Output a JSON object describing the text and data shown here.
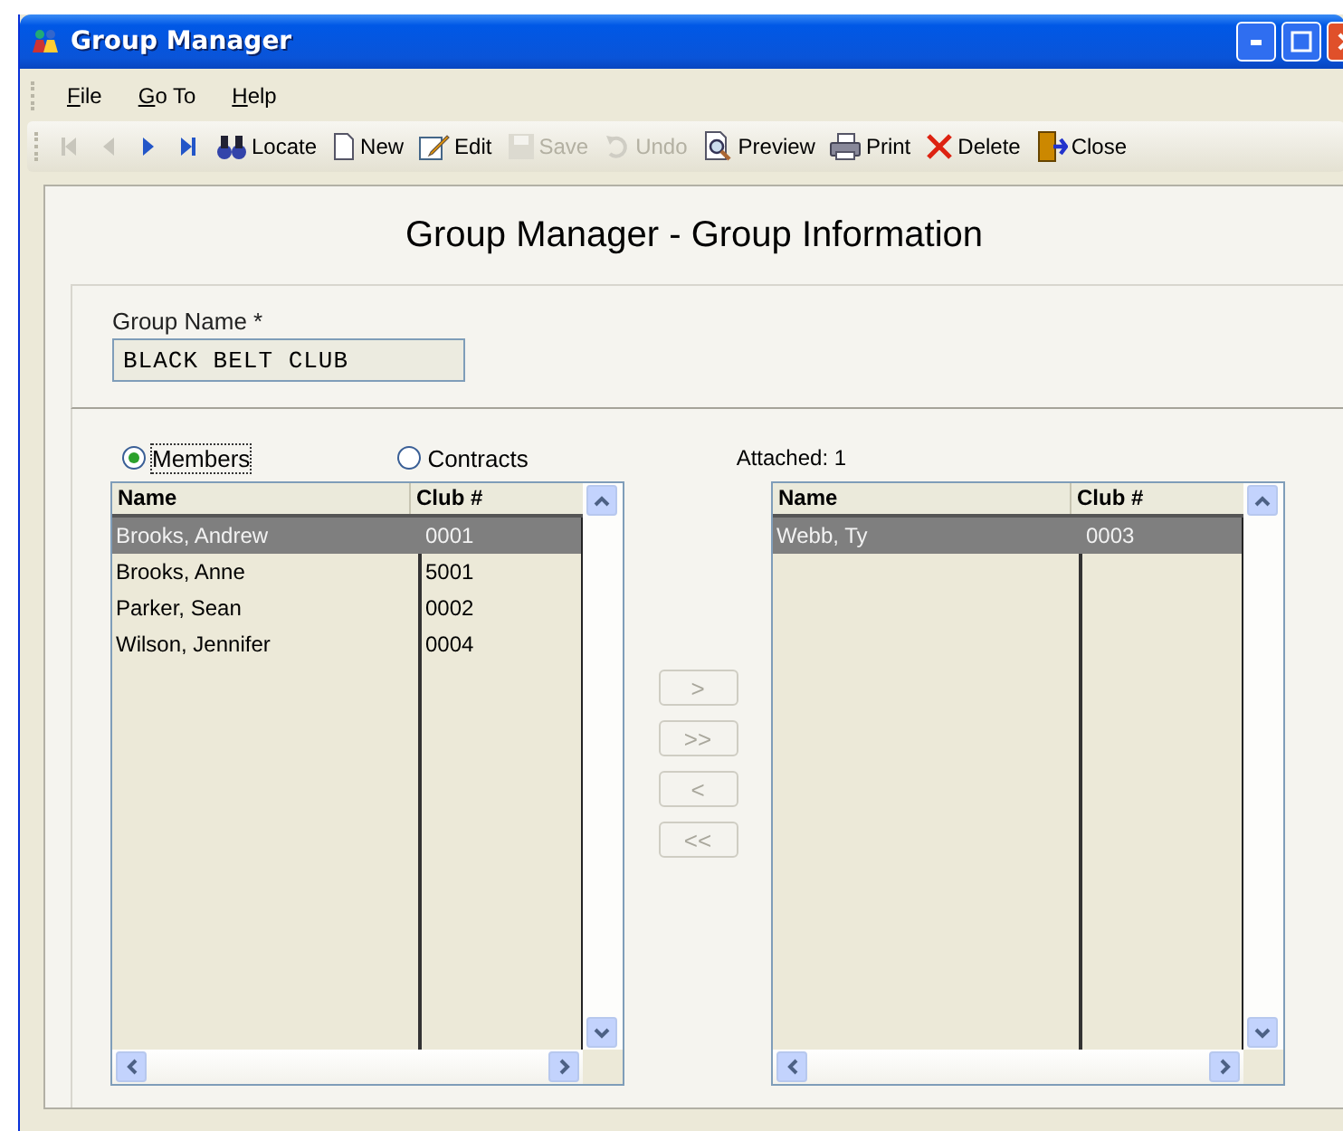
{
  "window": {
    "title": "Group Manager"
  },
  "menu": [
    {
      "label": "File"
    },
    {
      "label": "Go To"
    },
    {
      "label": "Help"
    }
  ],
  "toolbar": [
    {
      "kind": "first",
      "disabled": true
    },
    {
      "kind": "prev",
      "disabled": true
    },
    {
      "kind": "next",
      "disabled": false
    },
    {
      "kind": "last",
      "disabled": false
    },
    {
      "kind": "locate",
      "label": "Locate",
      "disabled": false
    },
    {
      "kind": "new",
      "label": "New",
      "disabled": false
    },
    {
      "kind": "edit",
      "label": "Edit",
      "disabled": false
    },
    {
      "kind": "save",
      "label": "Save",
      "disabled": true
    },
    {
      "kind": "undo",
      "label": "Undo",
      "disabled": true
    },
    {
      "kind": "preview",
      "label": "Preview",
      "disabled": false
    },
    {
      "kind": "print",
      "label": "Print",
      "disabled": false
    },
    {
      "kind": "delete",
      "label": "Delete",
      "disabled": false
    },
    {
      "kind": "close",
      "label": "Close",
      "disabled": false
    }
  ],
  "heading": "Group Manager - Group Information",
  "group_name": {
    "label": "Group Name *",
    "value": "BLACK BELT CLUB"
  },
  "source": [
    {
      "label": "Members",
      "selected": true
    },
    {
      "label": "Contracts",
      "selected": false
    }
  ],
  "attached_label": "Attached: 1",
  "available_columns": [
    "Name",
    "Club #"
  ],
  "attached_columns": [
    "Name",
    "Club #"
  ],
  "available": [
    {
      "name": "Brooks, Andrew",
      "club": "0001",
      "selected": true
    },
    {
      "name": "Brooks, Anne",
      "club": "5001",
      "selected": false
    },
    {
      "name": "Parker, Sean",
      "club": "0002",
      "selected": false
    },
    {
      "name": "Wilson, Jennifer",
      "club": "0004",
      "selected": false
    }
  ],
  "attached": [
    {
      "name": "Webb, Ty",
      "club": "0003",
      "selected": true
    }
  ],
  "move_buttons": [
    ">",
    ">>",
    "<",
    "<<"
  ]
}
